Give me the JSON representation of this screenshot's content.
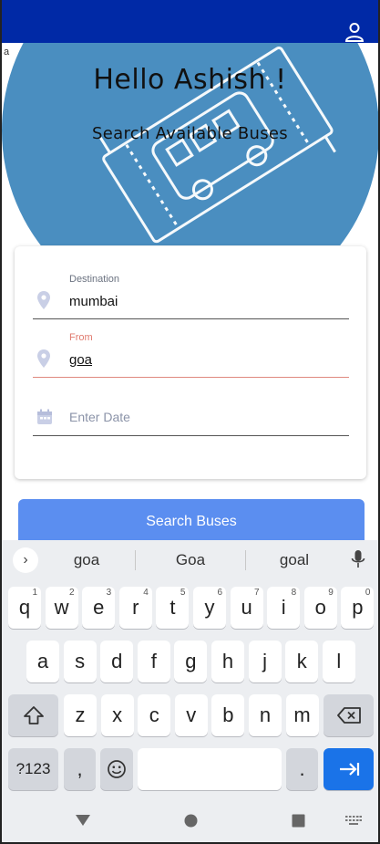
{
  "header": {
    "profile_icon": "person-icon",
    "bar_color": "#0029a6"
  },
  "stray_text": "a",
  "hero": {
    "greeting": "Hello Ashish !",
    "subtitle": "Search Available Buses",
    "circle_color": "#4a8ec0"
  },
  "form": {
    "destination": {
      "label": "Destination",
      "value": "mumbai",
      "icon": "location-pin-icon"
    },
    "from": {
      "label": "From",
      "value": "goa",
      "icon": "location-pin-icon"
    },
    "date": {
      "placeholder": "Enter Date",
      "icon": "calendar-icon"
    }
  },
  "search_button": {
    "label": "Search Buses",
    "color": "#5b8ef0"
  },
  "keyboard": {
    "suggestions": [
      "goa",
      "Goa",
      "goal"
    ],
    "row1": [
      [
        "q",
        "1"
      ],
      [
        "w",
        "2"
      ],
      [
        "e",
        "3"
      ],
      [
        "r",
        "4"
      ],
      [
        "t",
        "5"
      ],
      [
        "y",
        "6"
      ],
      [
        "u",
        "7"
      ],
      [
        "i",
        "8"
      ],
      [
        "o",
        "9"
      ],
      [
        "p",
        "0"
      ]
    ],
    "row2": [
      "a",
      "s",
      "d",
      "f",
      "g",
      "h",
      "j",
      "k",
      "l"
    ],
    "row3": [
      "z",
      "x",
      "c",
      "v",
      "b",
      "n",
      "m"
    ],
    "symbols_label": "?123",
    "comma": ",",
    "period": ".",
    "enter_color": "#1a73e8"
  },
  "navbar": {
    "back": "back-triangle-icon",
    "home": "home-circle-icon",
    "recents": "recents-square-icon",
    "keyboard": "keyboard-icon"
  }
}
